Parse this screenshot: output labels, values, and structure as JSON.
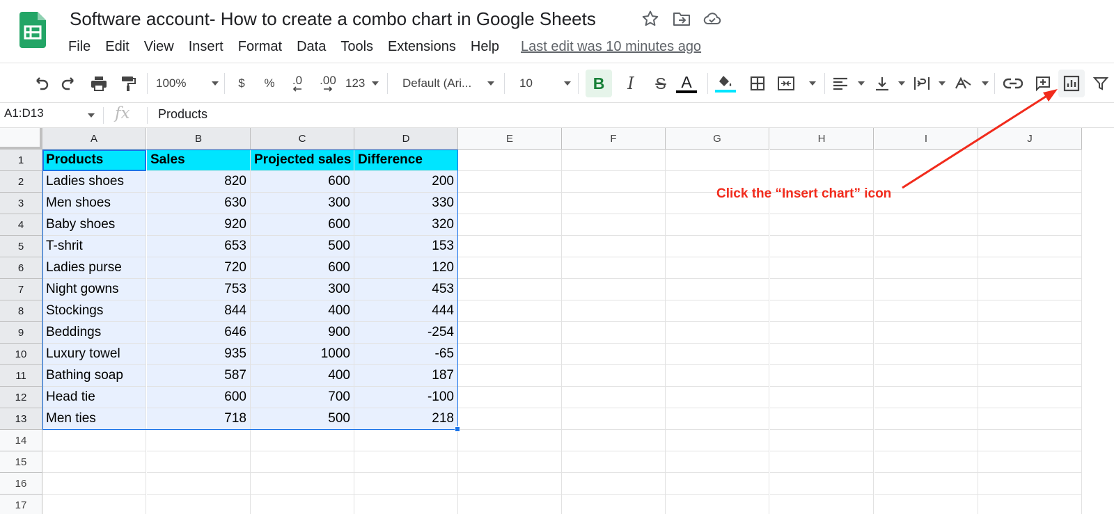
{
  "doc": {
    "title": "Software account- How to create a combo chart in Google Sheets",
    "last_edit": "Last edit was 10 minutes ago"
  },
  "menu": [
    "File",
    "Edit",
    "View",
    "Insert",
    "Format",
    "Data",
    "Tools",
    "Extensions",
    "Help"
  ],
  "toolbar": {
    "zoom": "100%",
    "currency": "$",
    "percent": "%",
    "decrease_decimal": ".0",
    "increase_decimal": ".00",
    "more_formats": "123",
    "font": "Default (Ari...",
    "font_size": "10",
    "bold": "B",
    "italic": "I",
    "strikethrough": "S",
    "text_color_letter": "A",
    "text_color": "#000000",
    "fill_color": "#00e5ff"
  },
  "formula_bar": {
    "name_box": "A1:D13",
    "fx": "fx",
    "content": "Products"
  },
  "sheet": {
    "columns": [
      "A",
      "B",
      "C",
      "D",
      "E",
      "F",
      "G",
      "H",
      "I",
      "J"
    ],
    "row_numbers": [
      "1",
      "2",
      "3",
      "4",
      "5",
      "6",
      "7",
      "8",
      "9",
      "10",
      "11",
      "12",
      "13",
      "14",
      "15",
      "16",
      "17"
    ],
    "header_fill": "#00e5ff",
    "headers": [
      "Products",
      "Sales",
      "Projected sales",
      "Difference"
    ],
    "rows": [
      [
        "Ladies shoes",
        "820",
        "600",
        "200"
      ],
      [
        "Men shoes",
        "630",
        "300",
        "330"
      ],
      [
        "Baby shoes",
        "920",
        "600",
        "320"
      ],
      [
        "T-shrit",
        "653",
        "500",
        "153"
      ],
      [
        "Ladies purse",
        "720",
        "600",
        "120"
      ],
      [
        "Night gowns",
        "753",
        "300",
        "453"
      ],
      [
        "Stockings",
        "844",
        "400",
        "444"
      ],
      [
        "Beddings",
        "646",
        "900",
        "-254"
      ],
      [
        "Luxury towel",
        "935",
        "1000",
        "-65"
      ],
      [
        "Bathing soap",
        "587",
        "400",
        "187"
      ],
      [
        "Head tie",
        "600",
        "700",
        "-100"
      ],
      [
        "Men ties",
        "718",
        "500",
        "218"
      ]
    ]
  },
  "annotation": {
    "text": "Click the “Insert chart” icon",
    "color": "#f12b1c"
  }
}
